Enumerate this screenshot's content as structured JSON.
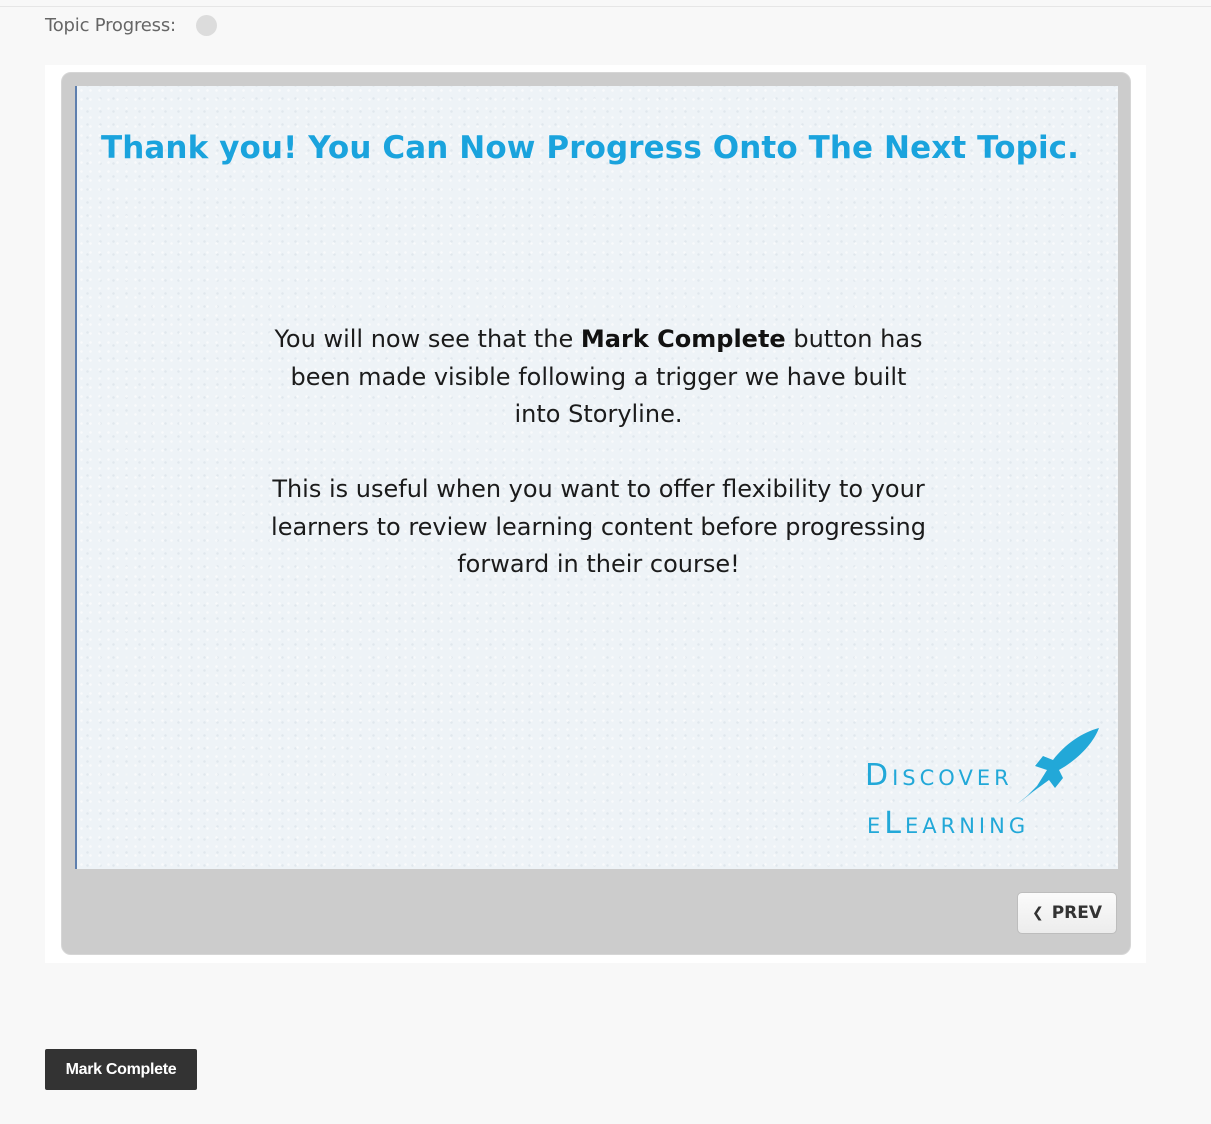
{
  "topic_progress": {
    "label": "Topic Progress:"
  },
  "slide": {
    "title": "Thank you! You Can Now Progress Onto The Next Topic.",
    "paragraph1_before": "You will now see that the ",
    "paragraph1_bold": "Mark Complete",
    "paragraph1_after": " button has been made visible following a trigger we have built into Storyline.",
    "paragraph2": "This is useful when you want to offer flexibility to your learners to review learning content before progressing forward in their course!",
    "logo": {
      "line1": "Discover",
      "line2": "eLearning",
      "color": "#22a8d8",
      "icon": "rocket-icon"
    }
  },
  "player": {
    "prev_label": "PREV",
    "prev_icon": "chevron-left-icon"
  },
  "mark_complete_label": "Mark Complete",
  "colors": {
    "title": "#1aa3dd",
    "button_dark": "#333333"
  }
}
